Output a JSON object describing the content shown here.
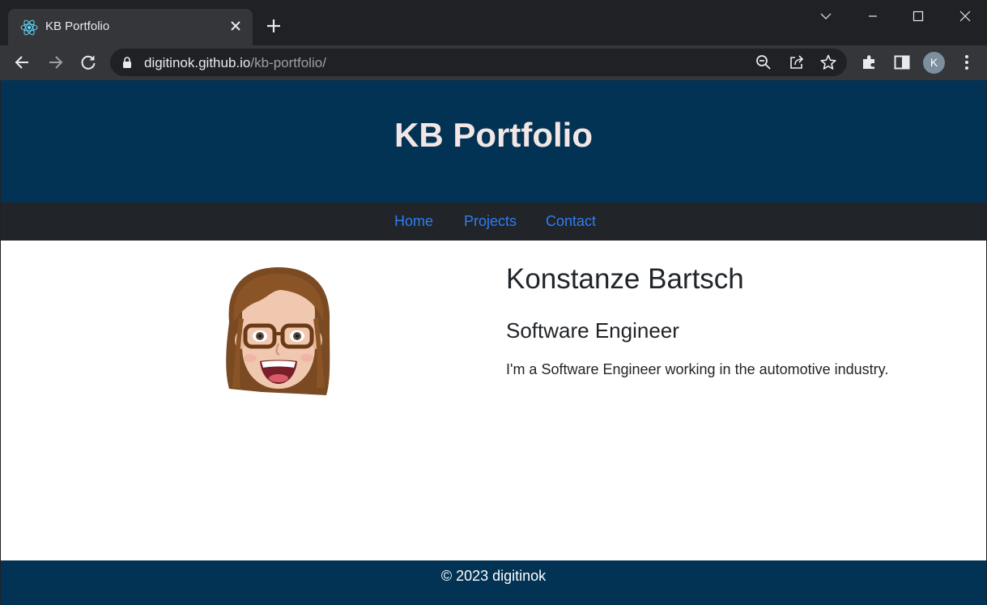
{
  "browser": {
    "tab_title": "KB Portfolio",
    "url_host": "digitinok.github.io",
    "url_path": "/kb-portfolio/",
    "profile_initial": "K",
    "icons": [
      "react-favicon-icon",
      "close-icon",
      "plus-icon",
      "chevron-down-icon",
      "minimize-icon",
      "maximize-icon",
      "window-close-icon",
      "back-icon",
      "forward-icon",
      "reload-icon",
      "lock-icon",
      "zoom-icon",
      "share-icon",
      "star-icon",
      "extensions-icon",
      "side-panel-icon",
      "menu-icon"
    ]
  },
  "header": {
    "title": "KB Portfolio"
  },
  "nav": {
    "items": [
      {
        "label": "Home"
      },
      {
        "label": "Projects"
      },
      {
        "label": "Contact"
      }
    ]
  },
  "profile": {
    "name": "Konstanze Bartsch",
    "role": "Software Engineer",
    "bio": "I'm a Software Engineer working in the automotive industry."
  },
  "footer": {
    "copyright": "© 2023 digitinok"
  },
  "colors": {
    "chrome_dark": "#202124",
    "chrome_tab": "#35363a",
    "hero_bg": "#023354",
    "title_color": "#f3e6e4",
    "nav_bg": "#212428",
    "nav_link": "#2e7df5",
    "text": "#212529"
  }
}
